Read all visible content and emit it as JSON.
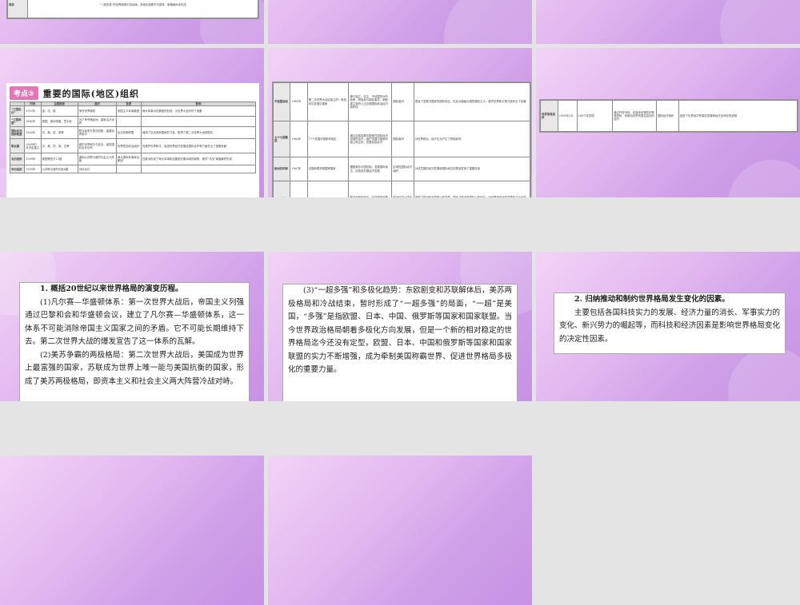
{
  "slide1": {
    "row_label": "现状",
    "row_text": "“一超多强”的世界局势仍将持续，多极化趋势不可逆转，新格局尚未形成"
  },
  "slide4": {
    "badge": "考点③",
    "title": "重要的国际(地区)组织",
    "headers": [
      "",
      "时间",
      "主要国家",
      "目的",
      "性质",
      "影响"
    ],
    "rows": [
      [
        "“三国协约”",
        "1907年",
        "英、法、俄",
        "争夺世界霸权",
        "帝国主义军事集团",
        "两大军事对抗集团的形成，为世界大战作好了准备"
      ],
      [
        "“三国同盟”",
        "1882年",
        "德国、奥匈帝国、意大利",
        "为了争夺殖民地，重新瓜分世界",
        "",
        ""
      ],
      [
        "国际反法西斯联盟",
        "1942年",
        "中、美、苏、英等",
        "联合起来打败法西斯，重建世界和平",
        "反法西斯联盟",
        "增强了反法西斯国家的力量，取得了第二次世界大战的胜利"
      ],
      [
        "联合国",
        "1945年2月决定建立",
        "中、美、苏、英、法等",
        "维护世界和平与安全，促进国际友好合作",
        "世界性的政治组织",
        "在维护世界和平、促进世界经济发展及国际合作等方面作出了重要贡献"
      ],
      [
        "北约组织",
        "1949年",
        "美国等西方12国",
        "遏制以苏联为首的社会主义阵营",
        "两大国际军事政治集团",
        "在欧洲形成了两大军事政治集团长期对峙的局势，美苏“冷战”局面最终形成"
      ],
      [
        "华约组织",
        "1955年",
        "以苏联为首的东欧8国",
        "对抗北约",
        "",
        ""
      ]
    ]
  },
  "slide5": {
    "rows": [
      [
        "不结盟运动",
        "1961年",
        "第二次世界大战后独立的一批亚非拉发展中国家",
        "奉行独立、自主、不结盟的对外政策，积极参与国际事务，争取建立新的公正合理国际政治经济新秩序",
        "国际组织",
        "提高了发展中国家的国际地位，在反对超级大国的霸权主义，维护世界和平等方面作出了贡献"
      ],
      [
        "七十七国集团",
        "1964年",
        "77个发展中国家和地区",
        "通过加强发展中国家在国际经济领域的合作，维护发展中国家的独立和主权，发展民族经济",
        "国际组织",
        "对世界政治、经济生活产生了积极影响"
      ],
      [
        "欧洲共同体",
        "1967年",
        "法国和联邦德国等国家",
        "摆脱美苏大国控制，发展国际地位，加快成员国经济发展",
        "区域性国际经济组织",
        "对成员国的经济发展和国际地位的提高发挥了重要作用"
      ],
      [
        "欧洲联盟",
        "1993年",
        "西欧国家",
        "联合起来在政治、经济和安全等方面更好地发展",
        "欧洲经济一体化的高级阶段",
        "促进了欧洲政治的统一和发展，提升了欧洲在国际上的地位，对世界多极化的发展起了巨大的作用，推动了世界经济一体化的进程"
      ]
    ]
  },
  "slide6": {
    "row": [
      "世界贸易组织",
      "1995年1月",
      "160个成员国",
      "通过开放市场，实施非歧视性的贸易原则，来推动世界贸易自由化的目的",
      "国际经济组织",
      "促进了世界经济贸易的发展和经济全球化的进程"
    ]
  },
  "slide7": {
    "title": "1. 概括20世纪以来世界格局的演变历程。",
    "paragraphs": [
      "(1)凡尔赛—华盛顿体系：第一次世界大战后，帝国主义列强通过巴黎和会和华盛顿会议，建立了凡尔赛—华盛顿体系，这一体系不可能消除帝国主义国家之间的矛盾。它不可能长期维持下去。第二次世界大战的爆发宣告了这一体系的瓦解。",
      "(2)美苏争霸的两极格局：第二次世界大战后，美国成为世界上最富强的国家，苏联成为世界上唯一能与美国抗衡的国家，形成了美苏两极格局，即资本主义和社会主义两大阵营冷战对峙。"
    ]
  },
  "slide8": {
    "paragraphs": [
      "(3)“一超多强”和多极化趋势：东欧剧变和苏联解体后，美苏两极格局和冷战结束，暂时形成了“一超多强”的局面，“一超”是美国，“多强”是指欧盟、日本、中国、俄罗斯等国家和国家联盟。当今世界政治格局朝着多极化方向发展，但是一个新的相对稳定的世界格局迄今还没有定型，欧盟、日本、中国和俄罗斯等国家和国家联盟的实力不断增强，成为牵制美国称霸世界、促进世界格局多极化的重要力量。"
    ]
  },
  "slide9": {
    "title": "2. 归纳推动和制约世界格局发生变化的因素。",
    "paragraphs": [
      "主要包括各国科技实力的发展、经济力量的消长、军事实力的变化、新兴势力的崛起等，而科技和经济因素是影响世界格局变化的决定性因素。"
    ]
  }
}
